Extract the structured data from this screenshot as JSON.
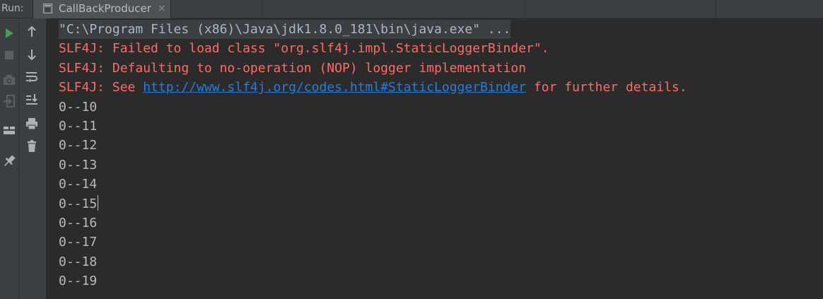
{
  "header": {
    "run_label": "Run:",
    "tab_title": "CallBackProducer",
    "tab_close": "×"
  },
  "toolbar_left": [
    {
      "name": "rerun-icon",
      "color": "#499c54"
    },
    {
      "name": "stop-icon",
      "color": "#5d5f61"
    },
    {
      "name": "camera-icon",
      "color": "#5d5f61"
    },
    {
      "name": "exit-icon",
      "color": "#5d5f61"
    },
    {
      "name": "layout-icon",
      "color": "#afb1b3"
    },
    {
      "name": "pin-icon",
      "color": "#afb1b3"
    }
  ],
  "toolbar_right": [
    {
      "name": "up-stack-trace-icon"
    },
    {
      "name": "down-stack-trace-icon"
    },
    {
      "name": "soft-wrap-icon"
    },
    {
      "name": "scroll-to-end-icon"
    },
    {
      "name": "print-icon"
    },
    {
      "name": "clear-all-icon"
    }
  ],
  "console": {
    "command": "\"C:\\Program Files (x86)\\Java\\jdk1.8.0_181\\bin\\java.exe\" ...",
    "err1": "SLF4J: Failed to load class \"org.slf4j.impl.StaticLoggerBinder\".",
    "err2": "SLF4J: Defaulting to no-operation (NOP) logger implementation",
    "err3_prefix": "SLF4J: See ",
    "err3_link": "http://www.slf4j.org/codes.html#StaticLoggerBinder",
    "err3_suffix": " for further details.",
    "output": [
      "0--10",
      "0--11",
      "0--12",
      "0--13",
      "0--14",
      "0--15",
      "0--16",
      "0--17",
      "0--18",
      "0--19"
    ]
  },
  "colors": {
    "background": "#2b2b2b",
    "toolbar": "#3c3f41",
    "error": "#ff6b68",
    "link": "#287bde",
    "output": "#bbbbbb",
    "run_green": "#499c54"
  }
}
